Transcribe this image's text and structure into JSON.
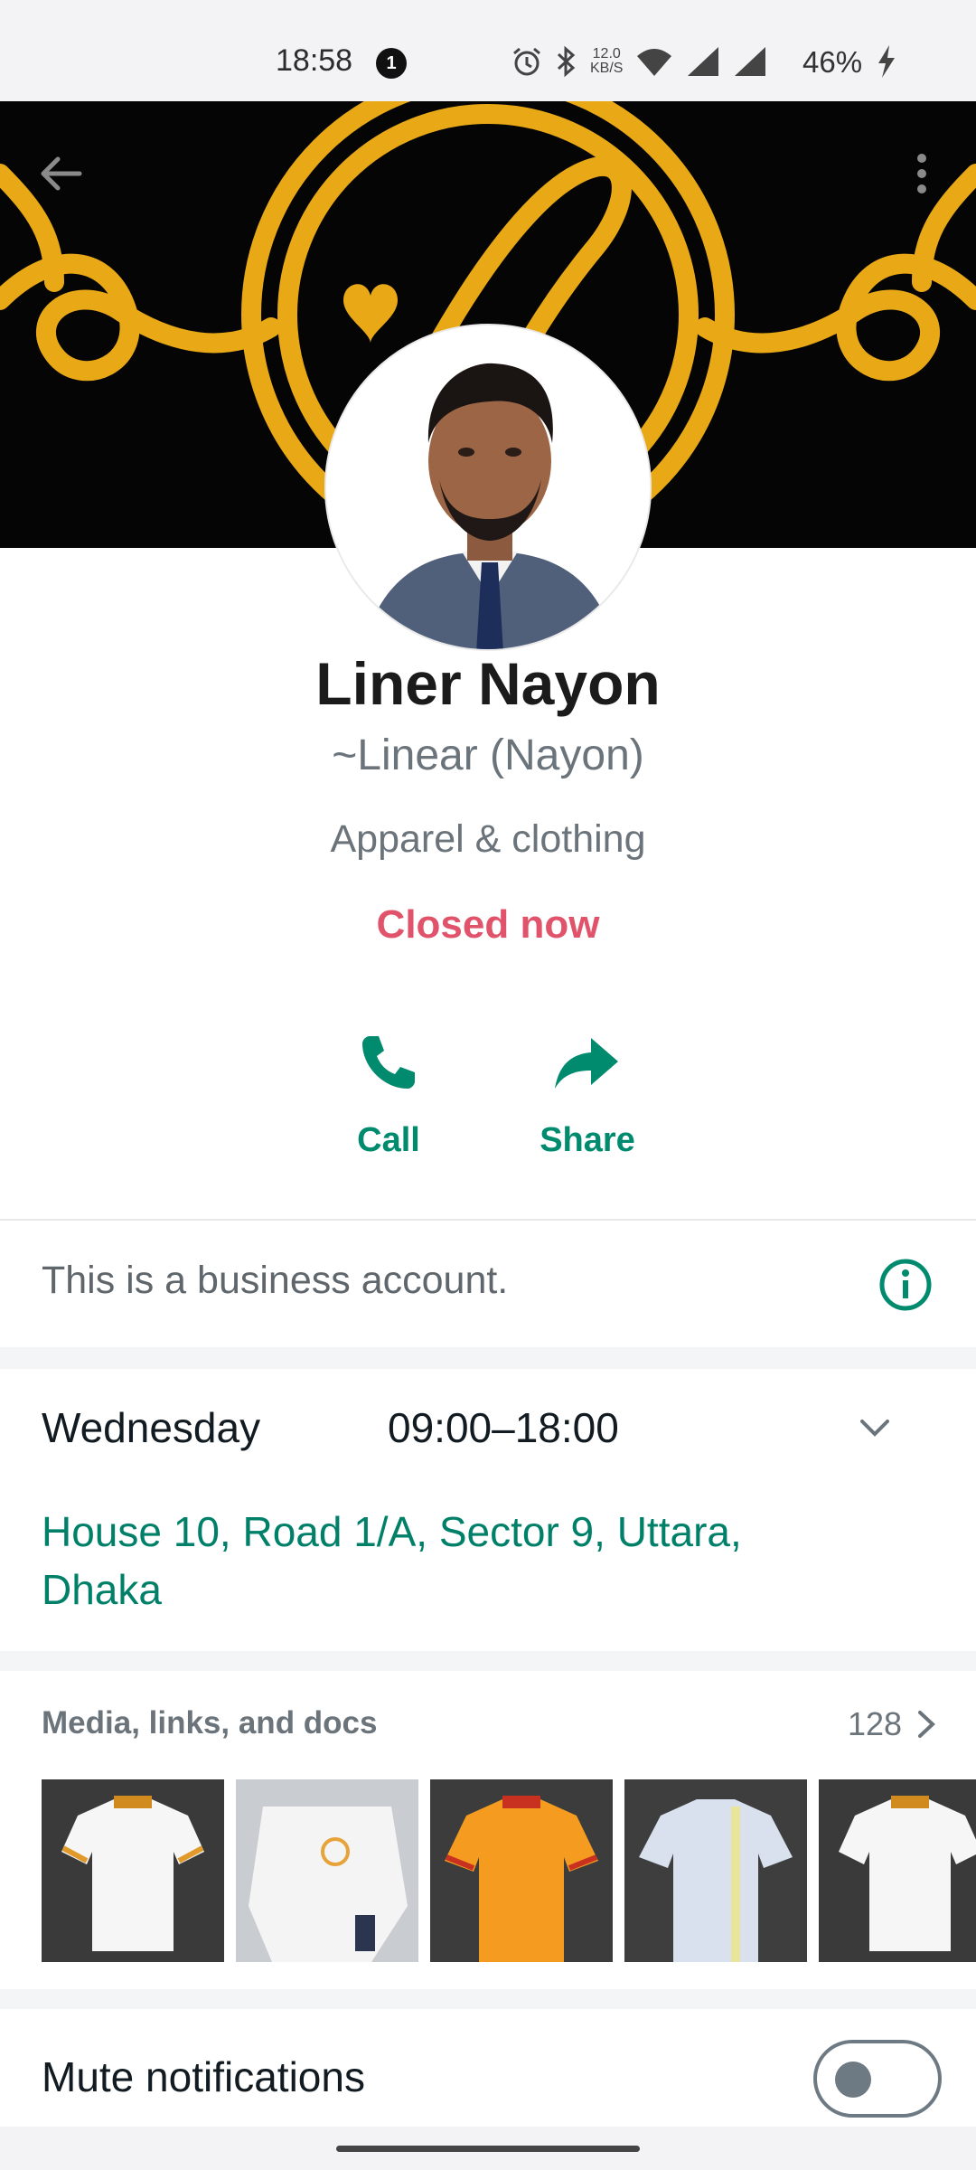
{
  "status_bar": {
    "time": "18:58",
    "notification_count": "1",
    "network_speed_value": "12.0",
    "network_speed_unit": "KB/S",
    "battery": "46%",
    "icons": [
      "alarm-icon",
      "bluetooth-icon",
      "wifi-icon",
      "signal-icon",
      "signal-icon",
      "charging-icon"
    ]
  },
  "header": {
    "back_icon": "arrow-left-icon",
    "menu_icon": "more-vertical-icon"
  },
  "profile": {
    "name": "Liner Nayon",
    "subname": "~Linear (Nayon)",
    "category": "Apparel & clothing",
    "open_status": "Closed now"
  },
  "actions": [
    {
      "label": "Call",
      "icon": "phone-icon"
    },
    {
      "label": "Share",
      "icon": "share-icon"
    }
  ],
  "business_notice": {
    "text": "This is a business account.",
    "icon": "info-icon"
  },
  "hours": {
    "day": "Wednesday",
    "time": "09:00–18:00",
    "address": "House 10, Road 1/A, Sector 9, Uttara, Dhaka"
  },
  "media": {
    "title": "Media, links, and docs",
    "count": "128",
    "thumbnails": [
      "white polo shirt",
      "white shirt folded",
      "orange polo shirt",
      "light blue polo shirt",
      "white polo shirt"
    ]
  },
  "settings": {
    "mute_label": "Mute notifications",
    "mute_enabled": false
  },
  "colors": {
    "accent": "#008069",
    "closed": "#e0536b",
    "cover_gold": "#e9a916"
  }
}
